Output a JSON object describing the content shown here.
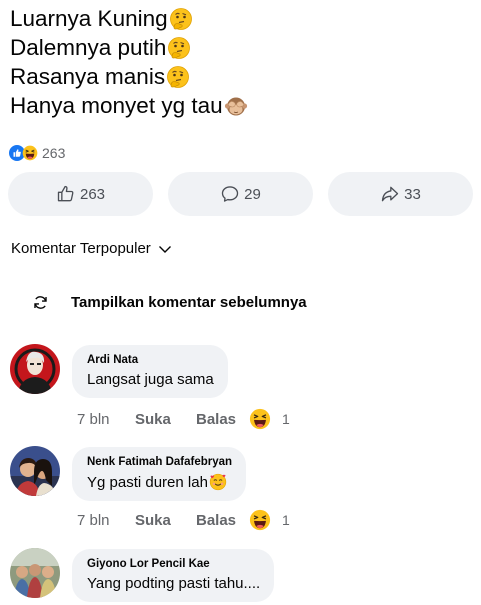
{
  "post": {
    "lines": [
      "Luarnya Kuning",
      "Dalemnya putih",
      "Rasanya manis",
      "Hanya monyet yg tau"
    ]
  },
  "reactions": {
    "count": "263"
  },
  "actions": {
    "like_count": "263",
    "comment_count": "29",
    "share_count": "33"
  },
  "sort": {
    "label": "Komentar Terpopuler"
  },
  "previous": {
    "label": "Tampilkan komentar sebelumnya"
  },
  "comments": [
    {
      "name": "Ardi Nata",
      "text": "Langsat juga sama",
      "time": "7 bln",
      "like": "Suka",
      "reply": "Balas",
      "reaction_count": "1"
    },
    {
      "name": "Nenk Fatimah Dafafebryan",
      "text": "Yg pasti duren lah",
      "time": "7 bln",
      "like": "Suka",
      "reply": "Balas",
      "reaction_count": "1"
    },
    {
      "name": "Giyono Lor Pencil Kae",
      "text": "Yang podting pasti tahu...."
    }
  ],
  "icons": {
    "thinking": "thinking-face-icon",
    "see_no_evil": "see-no-evil-monkey-icon",
    "like": "like-reaction-icon",
    "haha": "haha-reaction-icon",
    "thumb": "thumbs-up-icon",
    "comment": "comment-icon",
    "share": "share-icon",
    "chevron": "chevron-down-icon",
    "refresh": "refresh-icon",
    "smiling_hearts": "smiling-face-with-hearts-icon"
  },
  "colors": {
    "like_blue": "#1877f2",
    "emoji_yellow": "#fcc21b",
    "muted_text": "#65676b",
    "bubble_bg": "#f0f2f5"
  }
}
